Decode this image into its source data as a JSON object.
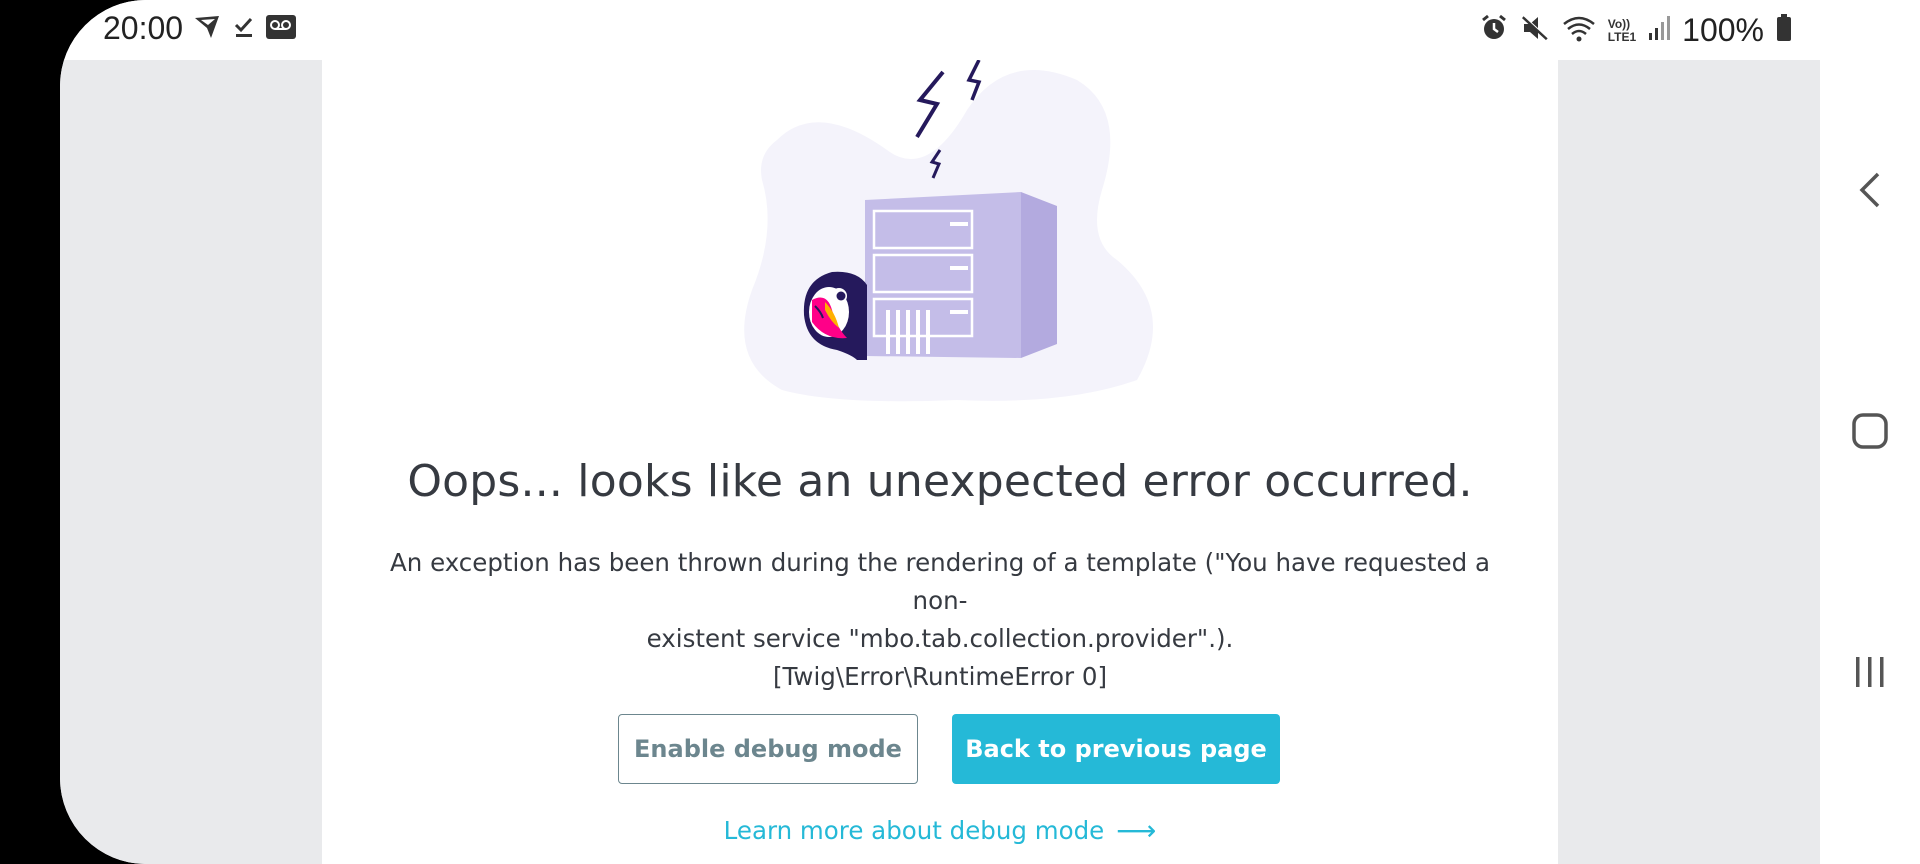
{
  "status_bar": {
    "time": "20:00",
    "battery": "100%",
    "left_icons": [
      "navigation-icon",
      "check-icon",
      "voicemail-icon"
    ],
    "right_icons": [
      "alarm-icon",
      "mute-icon",
      "wifi-icon",
      "volte-icon",
      "signal-icon",
      "battery-icon"
    ],
    "network_label_top": "Vo))",
    "network_label_bottom": "LTE1"
  },
  "error_page": {
    "title": "Oops... looks like an unexpected error occurred.",
    "message_line1": "An exception has been thrown during the rendering of a template (\"You have requested a non-",
    "message_line2": "existent service \"mbo.tab.collection.provider\".).",
    "error_code": "[Twig\\Error\\RuntimeError 0]",
    "enable_debug_label": "Enable debug mode",
    "back_label": "Back to previous page",
    "learn_more_label": "Learn more about debug mode",
    "learn_more_arrow": "⟶"
  },
  "nav_bar": {
    "icons": [
      "back-icon",
      "home-icon",
      "recents-icon"
    ]
  },
  "colors": {
    "accent": "#25b9d7",
    "text": "#363a41",
    "outline_button": "#6c868e",
    "page_background": "#e9eaec",
    "illustration_blob": "#f4f3fb",
    "server": "#c4bde8",
    "lightning": "#25195c"
  }
}
